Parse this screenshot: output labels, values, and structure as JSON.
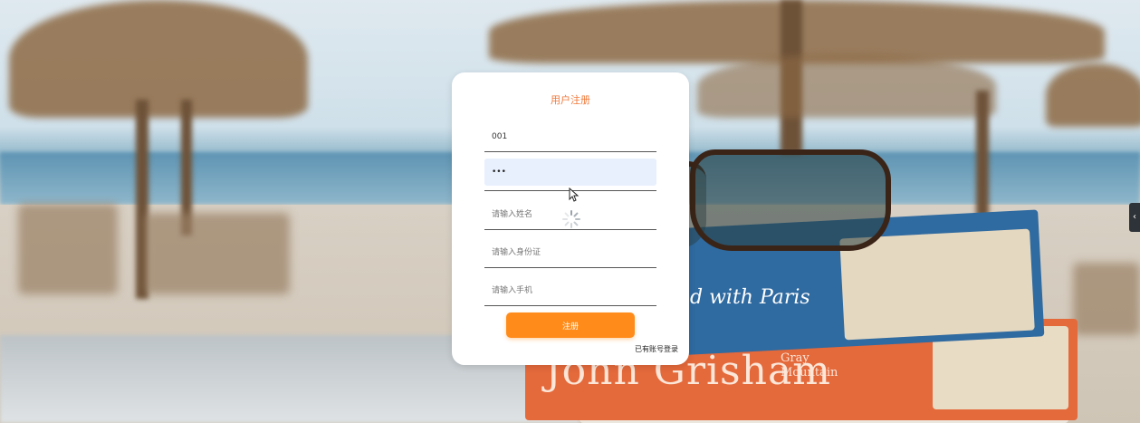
{
  "background": {
    "book_blue_text": "d with Paris",
    "book_orange_text": "John Grisham",
    "book_orange_sub": "Gray Mountain"
  },
  "register_form": {
    "title": "用户注册",
    "fields": {
      "username": {
        "value": "001",
        "placeholder": ""
      },
      "password": {
        "value": "•••",
        "placeholder": ""
      },
      "name": {
        "value": "",
        "placeholder": "请输入姓名"
      },
      "id_card": {
        "value": "",
        "placeholder": "请输入身份证"
      },
      "phone": {
        "value": "",
        "placeholder": "请输入手机"
      }
    },
    "submit_label": "注册",
    "login_link": "已有账号登录"
  },
  "side_tab_icon": "chevron-left-icon",
  "side_tab_glyph": "‹",
  "colors": {
    "accent": "#ff8c1a",
    "title": "#f07a3c",
    "focused_field": "#e8f0fe"
  }
}
